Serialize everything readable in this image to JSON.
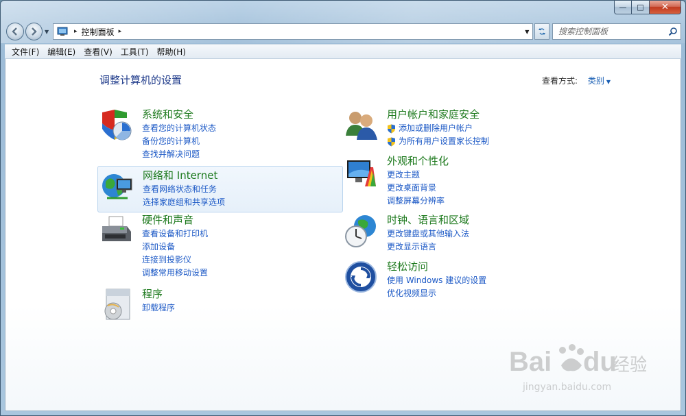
{
  "window": {
    "caption": {
      "min": "—",
      "max": "□",
      "close": "✕"
    }
  },
  "address": {
    "root_sep": "▸",
    "crumbs": [
      "控制面板"
    ],
    "end_sep": "▸",
    "search_placeholder": "搜索控制面板"
  },
  "menu": [
    "文件(F)",
    "编辑(E)",
    "查看(V)",
    "工具(T)",
    "帮助(H)"
  ],
  "content": {
    "title": "调整计算机的设置",
    "view_by_label": "查看方式:",
    "view_by_value": "类别"
  },
  "categories": [
    {
      "title": "系统和安全",
      "icon": "system-security-icon",
      "links": [
        "查看您的计算机状态",
        "备份您的计算机",
        "查找并解决问题"
      ]
    },
    {
      "title": "网络和 Internet",
      "icon": "network-internet-icon",
      "links": [
        "查看网络状态和任务",
        "选择家庭组和共享选项"
      ]
    },
    {
      "title": "硬件和声音",
      "icon": "printer-icon",
      "links": [
        "查看设备和打印机",
        "添加设备",
        "连接到投影仪",
        "调整常用移动设置"
      ]
    },
    {
      "title": "程序",
      "icon": "programs-icon",
      "links": [
        "卸载程序"
      ]
    },
    {
      "title": "用户帐户和家庭安全",
      "icon": "users-icon",
      "links": [
        "添加或删除用户帐户",
        "为所有用户设置家长控制"
      ]
    },
    {
      "title": "外观和个性化",
      "icon": "appearance-icon",
      "links": [
        "更改主题",
        "更改桌面背景",
        "调整屏幕分辨率"
      ]
    },
    {
      "title": "时钟、语言和区域",
      "icon": "clock-globe-icon",
      "links": [
        "更改键盘或其他输入法",
        "更改显示语言"
      ]
    },
    {
      "title": "轻松访问",
      "icon": "ease-of-access-icon",
      "links": [
        "使用 Windows 建议的设置",
        "优化视频显示"
      ]
    }
  ],
  "watermark": {
    "brand": "Bai",
    "brand2": "du",
    "brand_cn": "经验",
    "url": "jingyan.baidu.com"
  }
}
